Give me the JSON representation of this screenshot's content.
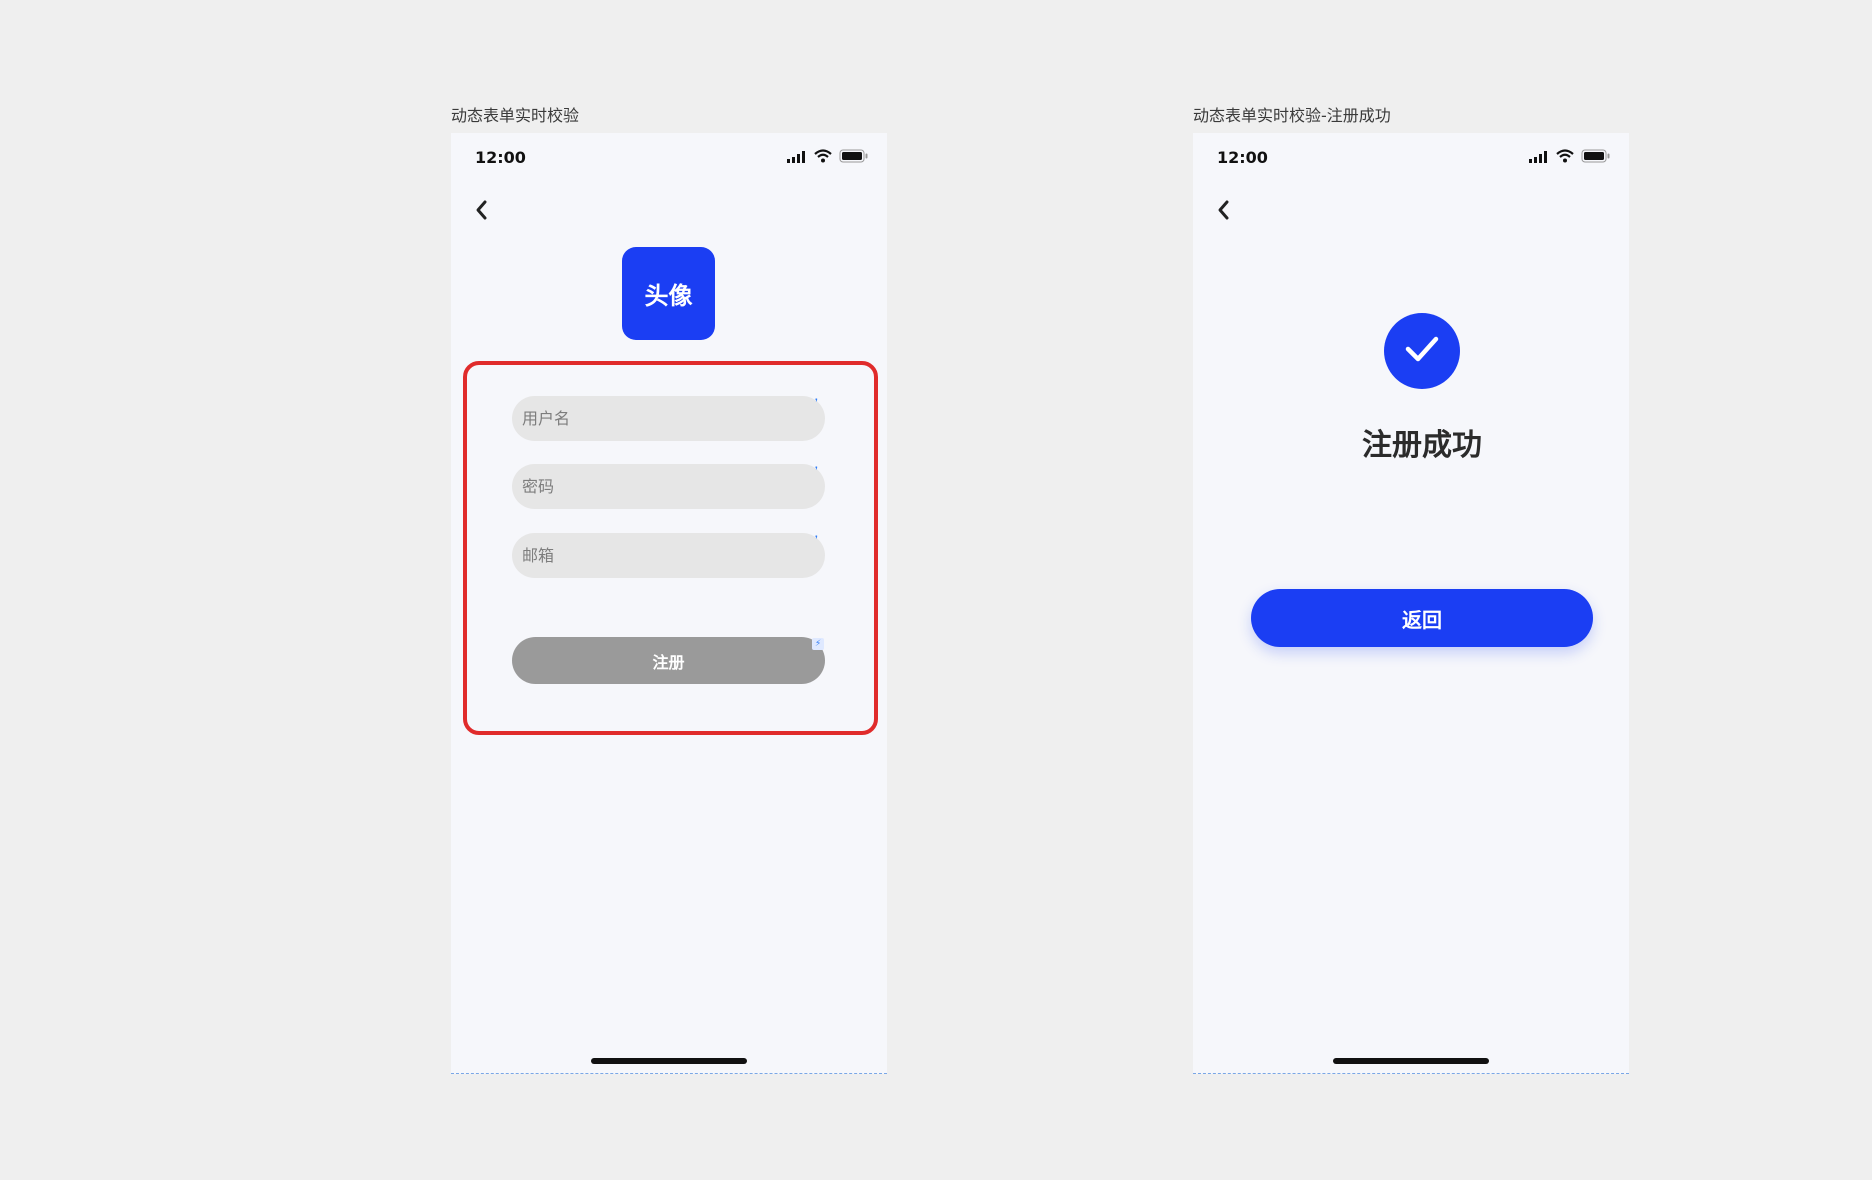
{
  "frames": {
    "form": {
      "title": "动态表单实时校验",
      "time": "12:00",
      "avatar_label": "头像",
      "fields": {
        "username_placeholder": "用户名",
        "password_placeholder": "密码",
        "email_placeholder": "邮箱"
      },
      "submit_label": "注册"
    },
    "success": {
      "title": "动态表单实时校验-注册成功",
      "time": "12:00",
      "heading": "注册成功",
      "return_label": "返回"
    }
  },
  "colors": {
    "canvas": "#efefef",
    "screen": "#f6f7fb",
    "primary": "#1b3ef3",
    "highlight": "#e02b2b",
    "input_bg": "#e6e6e6",
    "disabled_button": "#9a9a9a"
  },
  "icons": {
    "signal": "signal-icon",
    "wifi": "wifi-icon",
    "battery": "battery-icon",
    "back": "chevron-left-icon",
    "checkmark": "checkmark-icon",
    "lightning": "lightning-icon"
  }
}
